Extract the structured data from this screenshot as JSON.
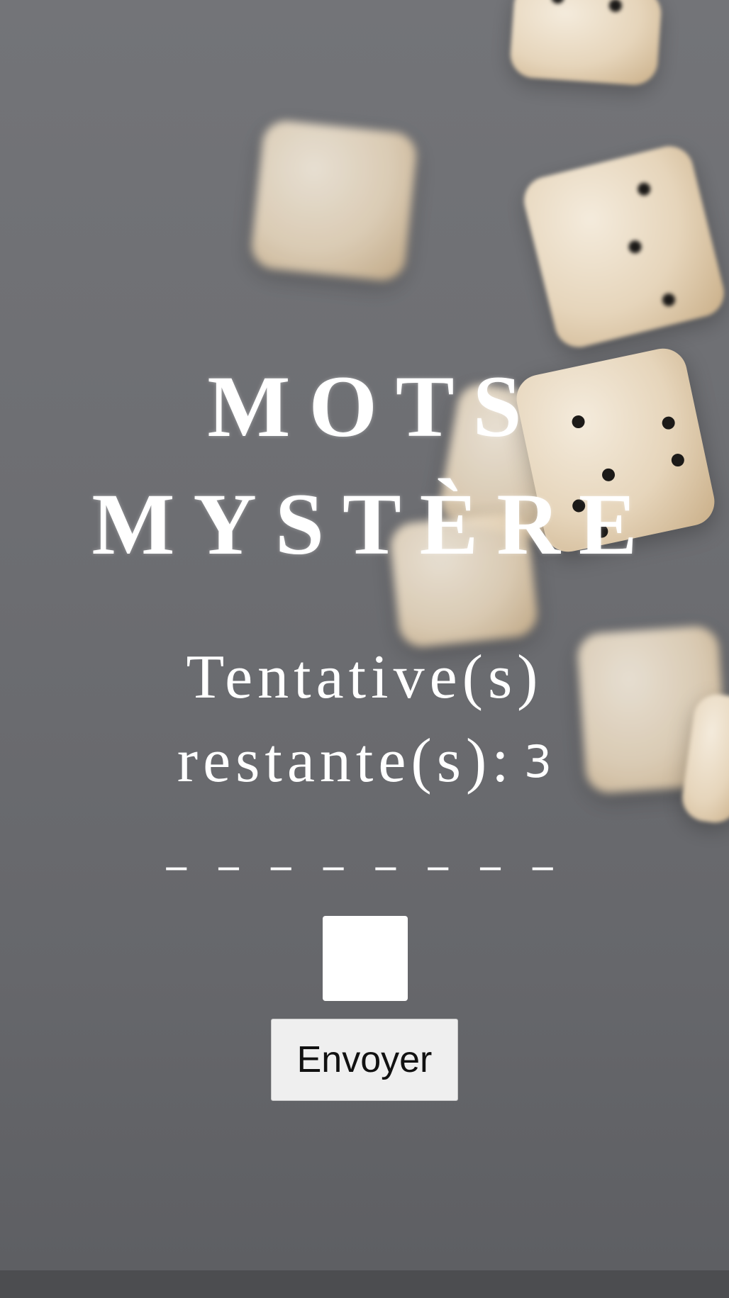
{
  "page": {
    "background_color": "#6f7074",
    "accent_text_color": "#ffffff"
  },
  "title": {
    "line1": "MOTS",
    "line2": "MYSTÈRE"
  },
  "attempts": {
    "line1": "Tentative(s)",
    "line2": "restante(s):",
    "count": "3"
  },
  "word_mask": "_ _ _ _ _ _ _ _",
  "guess_input": {
    "value": "",
    "placeholder": ""
  },
  "submit": {
    "label": "Envoyer"
  },
  "decoration": {
    "background_image": "dice-photo"
  }
}
